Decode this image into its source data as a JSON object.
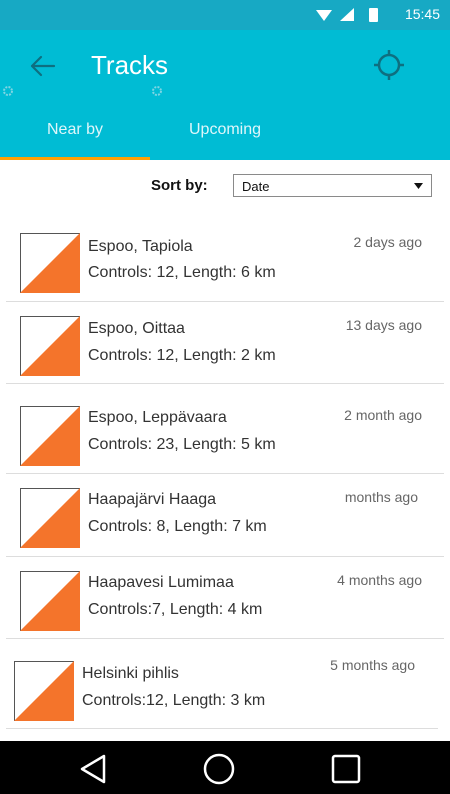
{
  "status_bar": {
    "time": "15:45"
  },
  "app_bar": {
    "title": "Tracks",
    "accent": "#00bcd4"
  },
  "tabs": [
    {
      "label": "Near by",
      "selected": true
    },
    {
      "label": "Upcoming",
      "selected": false
    }
  ],
  "sort": {
    "label": "Sort by:",
    "selected": "Date"
  },
  "tracks": [
    {
      "name": "Espoo, Tapiola",
      "details": "Controls: 12, Length: 6 km",
      "date": "2 days ago"
    },
    {
      "name": "Espoo, Oittaa",
      "details": "Controls: 12, Length: 2 km",
      "date": "13 days ago"
    },
    {
      "name": "Espoo, Leppävaara",
      "details": "Controls: 23, Length: 5 km",
      "date": "2 month ago"
    },
    {
      "name": "Haapajärvi Haaga",
      "details": "Controls: 8, Length: 7 km",
      "date": "months ago"
    },
    {
      "name": "Haapavesi Lumimaa",
      "details": "Controls:7, Length: 4 km",
      "date": "4 months ago"
    },
    {
      "name": "Helsinki pihlis",
      "details": "Controls:12, Length: 3 km",
      "date": "5 months ago"
    }
  ],
  "colors": {
    "thumb_fill": "#f4742b",
    "tab_indicator": "#ffa000"
  }
}
